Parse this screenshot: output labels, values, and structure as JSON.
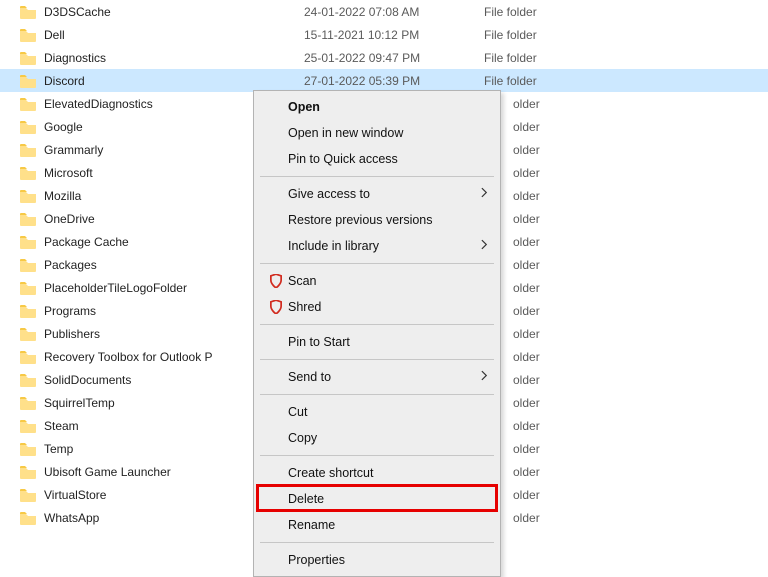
{
  "columns": {
    "type_folder": "File folder"
  },
  "files": [
    {
      "name": "D3DSCache",
      "date": "24-01-2022 07:08 AM"
    },
    {
      "name": "Dell",
      "date": "15-11-2021 10:12 PM"
    },
    {
      "name": "Diagnostics",
      "date": "25-01-2022 09:47 PM"
    },
    {
      "name": "Discord",
      "date": "27-01-2022 05:39 PM",
      "selected": true
    },
    {
      "name": "ElevatedDiagnostics"
    },
    {
      "name": "Google"
    },
    {
      "name": "Grammarly"
    },
    {
      "name": "Microsoft"
    },
    {
      "name": "Mozilla"
    },
    {
      "name": "OneDrive"
    },
    {
      "name": "Package Cache"
    },
    {
      "name": "Packages"
    },
    {
      "name": "PlaceholderTileLogoFolder"
    },
    {
      "name": "Programs"
    },
    {
      "name": "Publishers"
    },
    {
      "name": "Recovery Toolbox for Outlook P"
    },
    {
      "name": "SolidDocuments"
    },
    {
      "name": "SquirrelTemp"
    },
    {
      "name": "Steam"
    },
    {
      "name": "Temp"
    },
    {
      "name": "Ubisoft Game Launcher"
    },
    {
      "name": "VirtualStore"
    },
    {
      "name": "WhatsApp"
    }
  ],
  "trailing_type_text": "older",
  "context_menu": {
    "groups": [
      [
        {
          "label": "Open",
          "bold": true
        },
        {
          "label": "Open in new window"
        },
        {
          "label": "Pin to Quick access"
        }
      ],
      [
        {
          "label": "Give access to",
          "submenu": true
        },
        {
          "label": "Restore previous versions"
        },
        {
          "label": "Include in library",
          "submenu": true
        }
      ],
      [
        {
          "label": "Scan",
          "icon": "shield-red"
        },
        {
          "label": "Shred",
          "icon": "shield-red"
        }
      ],
      [
        {
          "label": "Pin to Start"
        }
      ],
      [
        {
          "label": "Send to",
          "submenu": true
        }
      ],
      [
        {
          "label": "Cut"
        },
        {
          "label": "Copy"
        }
      ],
      [
        {
          "label": "Create shortcut"
        },
        {
          "label": "Delete",
          "highlight": true
        },
        {
          "label": "Rename"
        }
      ],
      [
        {
          "label": "Properties"
        }
      ]
    ]
  }
}
